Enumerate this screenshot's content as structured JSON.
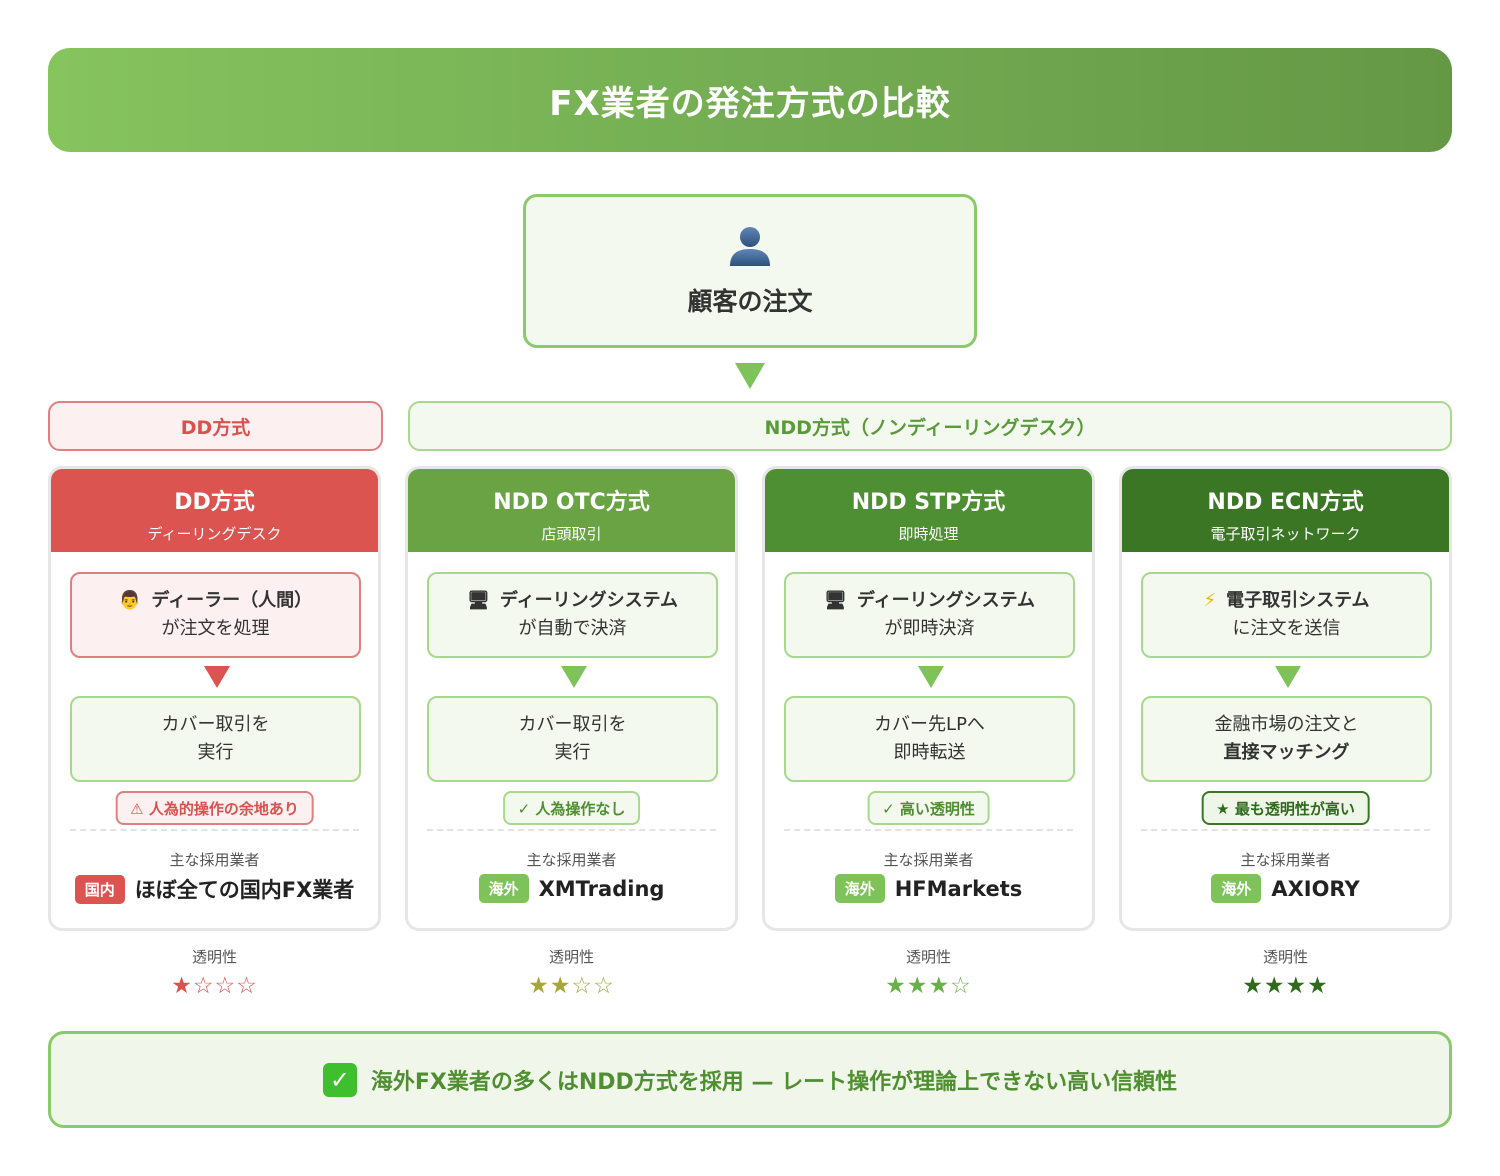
{
  "header": {
    "title": "FX業者の発注方式の比較"
  },
  "source": {
    "label": "顧客の注文",
    "icon": "user-silhouette-icon"
  },
  "groups": {
    "dd": "DD方式",
    "ndd": "NDD方式（ノンディーリングデスク）"
  },
  "colors": {
    "dd_red": "#d9524f",
    "otc_green": "#6aa344",
    "stp_green": "#4e8f33",
    "ecn_green": "#3b7624",
    "accent_green": "#7ec35a"
  },
  "columns": [
    {
      "title": "DD方式",
      "subtitle": "ディーリングデスク",
      "step1_icon": "👨",
      "step1_line1": "ディーラー（人間）",
      "step1_line2": "が注文を処理",
      "step2_line1": "カバー取引を",
      "step2_line2": "実行",
      "badge": "⚠ 人為的操作の余地あり",
      "adopt_label": "主な採用業者",
      "tag": "国内",
      "broker": "ほぼ全ての国内FX業者",
      "trans_label": "透明性",
      "stars": "★☆☆☆",
      "rating": 1
    },
    {
      "title": "NDD OTC方式",
      "subtitle": "店頭取引",
      "step1_icon": "🖥",
      "step1_line1": "ディーリングシステム",
      "step1_line2": "が自動で決済",
      "step2_line1": "カバー取引を",
      "step2_line2": "実行",
      "badge": "✓ 人為操作なし",
      "adopt_label": "主な採用業者",
      "tag": "海外",
      "broker": "XMTrading",
      "trans_label": "透明性",
      "stars": "★★☆☆",
      "rating": 2
    },
    {
      "title": "NDD STP方式",
      "subtitle": "即時処理",
      "step1_icon": "🖥",
      "step1_line1": "ディーリングシステム",
      "step1_line2": "が即時決済",
      "step2_line1": "カバー先LPへ",
      "step2_line2": "即時転送",
      "badge": "✓ 高い透明性",
      "adopt_label": "主な採用業者",
      "tag": "海外",
      "broker": "HFMarkets",
      "trans_label": "透明性",
      "stars": "★★★☆",
      "rating": 3
    },
    {
      "title": "NDD ECN方式",
      "subtitle": "電子取引ネットワーク",
      "step1_icon": "⚡",
      "step1_line1": "電子取引システム",
      "step1_line2": "に注文を送信",
      "step2_line1": "金融市場の注文と",
      "step2_line2": "直接マッチング",
      "badge": "★ 最も透明性が高い",
      "adopt_label": "主な採用業者",
      "tag": "海外",
      "broker": "AXIORY",
      "trans_label": "透明性",
      "stars": "★★★★",
      "rating": 4
    }
  ],
  "footer": {
    "check": "✓",
    "text": "海外FX業者の多くはNDD方式を採用 — レート操作が理論上できない高い信頼性"
  }
}
